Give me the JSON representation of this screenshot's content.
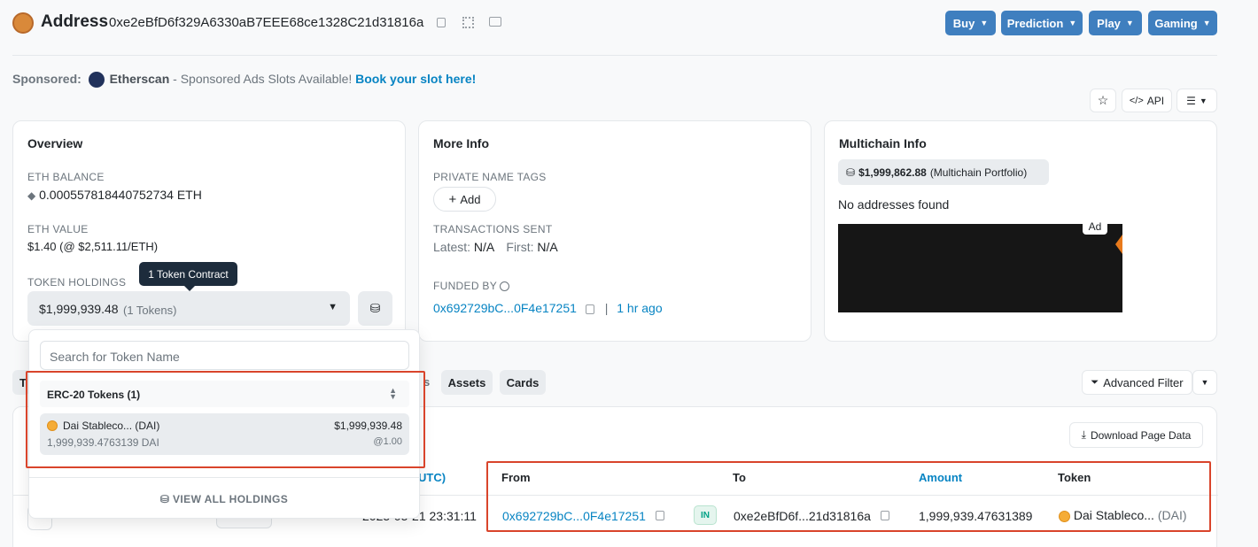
{
  "header": {
    "title": "Address",
    "address": "0xe2eBfD6f329A6330aB7EEE68ce1328C21d31816a",
    "nav": [
      {
        "label": "Buy"
      },
      {
        "label": "Prediction"
      },
      {
        "label": "Play"
      },
      {
        "label": "Gaming"
      }
    ]
  },
  "sponsored": {
    "prefix": "Sponsored:",
    "brand": "Etherscan",
    "text": " - Sponsored Ads Slots Available!",
    "link": "Book your slot here!"
  },
  "toolbar": {
    "api_label": "API"
  },
  "overview": {
    "title": "Overview",
    "eth_balance_label": "ETH BALANCE",
    "eth_balance": "0.000557818440752734 ETH",
    "eth_value_label": "ETH VALUE",
    "eth_value": "$1.40 (@ $2,511.11/ETH)",
    "token_holdings_label": "TOKEN HOLDINGS",
    "tooltip": "1 Token Contract",
    "holdings_value": "$1,999,939.48",
    "holdings_count": "(1 Tokens)"
  },
  "dropdown": {
    "search_placeholder": "Search for Token Name",
    "group_label": "ERC-20 Tokens (1)",
    "token": {
      "name": "Dai Stableco... (DAI)",
      "value": "$1,999,939.48",
      "amount": "1,999,939.4763139 DAI",
      "rate": "@1.00"
    },
    "view_all": "VIEW ALL HOLDINGS"
  },
  "more_info": {
    "title": "More Info",
    "private_tags_label": "PRIVATE NAME TAGS",
    "add_label": "Add",
    "tx_sent_label": "TRANSACTIONS SENT",
    "latest_label": "Latest:",
    "latest": "N/A",
    "first_label": "First:",
    "first": "N/A",
    "funded_by_label": "FUNDED BY",
    "funded_by": "0x692729bC...0F4e17251",
    "funded_time": "1 hr ago"
  },
  "multichain": {
    "title": "Multichain Info",
    "portfolio_value": "$1,999,862.88",
    "portfolio_label": "(Multichain Portfolio)",
    "no_addresses": "No addresses found",
    "ad_badge": "Ad"
  },
  "tabs": {
    "partial_left": "T",
    "partial_right": "s",
    "assets": "Assets",
    "cards": "Cards",
    "advanced_filter": "Advanced Filter"
  },
  "table": {
    "download": "Download Page Data",
    "time_header_partial": "UTC)",
    "columns": {
      "from": "From",
      "to": "To",
      "amount": "Amount",
      "token": "Token"
    },
    "row": {
      "time": "2025-05-21 23:31:11",
      "from": "0x692729bC...0F4e17251",
      "direction": "IN",
      "to": "0xe2eBfD6f...21d31816a",
      "amount": "1,999,939.47631389",
      "token_name": "Dai Stableco...",
      "token_symbol": "(DAI)"
    }
  },
  "colors": {
    "accent": "#3f7fbf",
    "link": "#0784c3",
    "highlight": "#d9442b"
  }
}
